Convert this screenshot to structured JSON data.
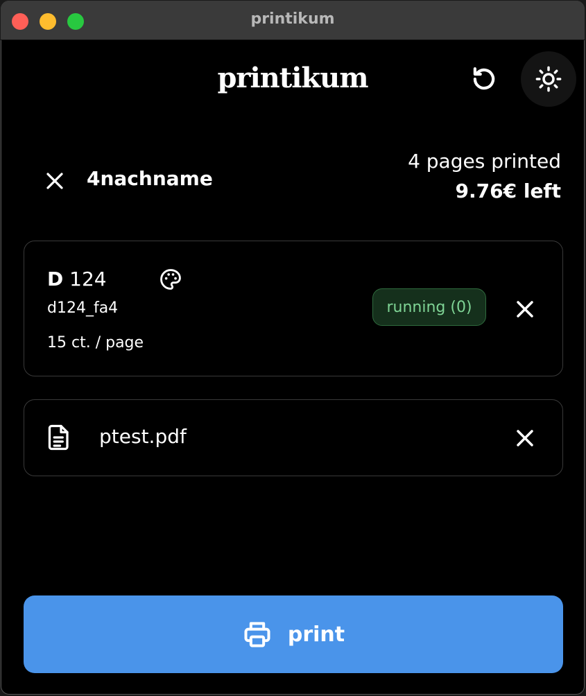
{
  "window": {
    "title": "printikum"
  },
  "header": {
    "logo": "printikum",
    "refresh_icon": "refresh-icon",
    "theme_icon": "sun-icon"
  },
  "user": {
    "name": "4nachname",
    "pages_printed": "4 pages printed",
    "balance": "9.76€ left"
  },
  "printer": {
    "building": "D",
    "room": "124",
    "id": "d124_fa4",
    "price": "15 ct. / page",
    "status": "running (0)",
    "color_icon": "palette-icon"
  },
  "file": {
    "name": "ptest.pdf",
    "icon": "document-icon"
  },
  "print_button": {
    "label": "print",
    "icon": "printer-icon"
  },
  "colors": {
    "background": "#000000",
    "accent": "#4a94ea",
    "status_bg": "#15301c",
    "status_text": "#7fd495"
  }
}
